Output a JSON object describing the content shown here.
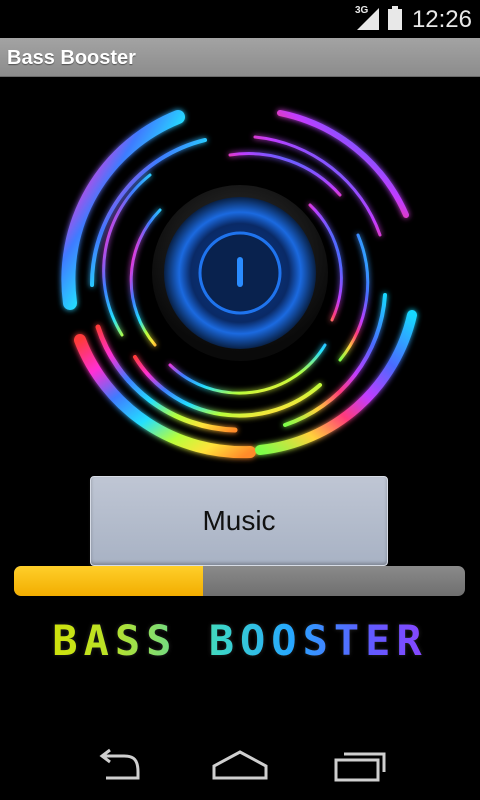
{
  "status_bar": {
    "network": "3G",
    "time": "12:26",
    "icons": [
      "signal-icon",
      "battery-icon"
    ]
  },
  "app": {
    "title": "Bass Booster"
  },
  "power_button": {
    "icon": "power-icon"
  },
  "music_button": {
    "label": "Music"
  },
  "bass_level": {
    "value": 0.42
  },
  "logo": {
    "text": "BASS BOOSTER"
  },
  "nav_bar": {
    "icons": [
      "back-icon",
      "home-icon",
      "recent-apps-icon"
    ]
  },
  "colors": {
    "title_bar": "#999999",
    "progress_fill": "#f7bb00",
    "progress_track": "#7a7a7a",
    "button": "#b4bccc",
    "accent_blue": "#1a64d6"
  }
}
